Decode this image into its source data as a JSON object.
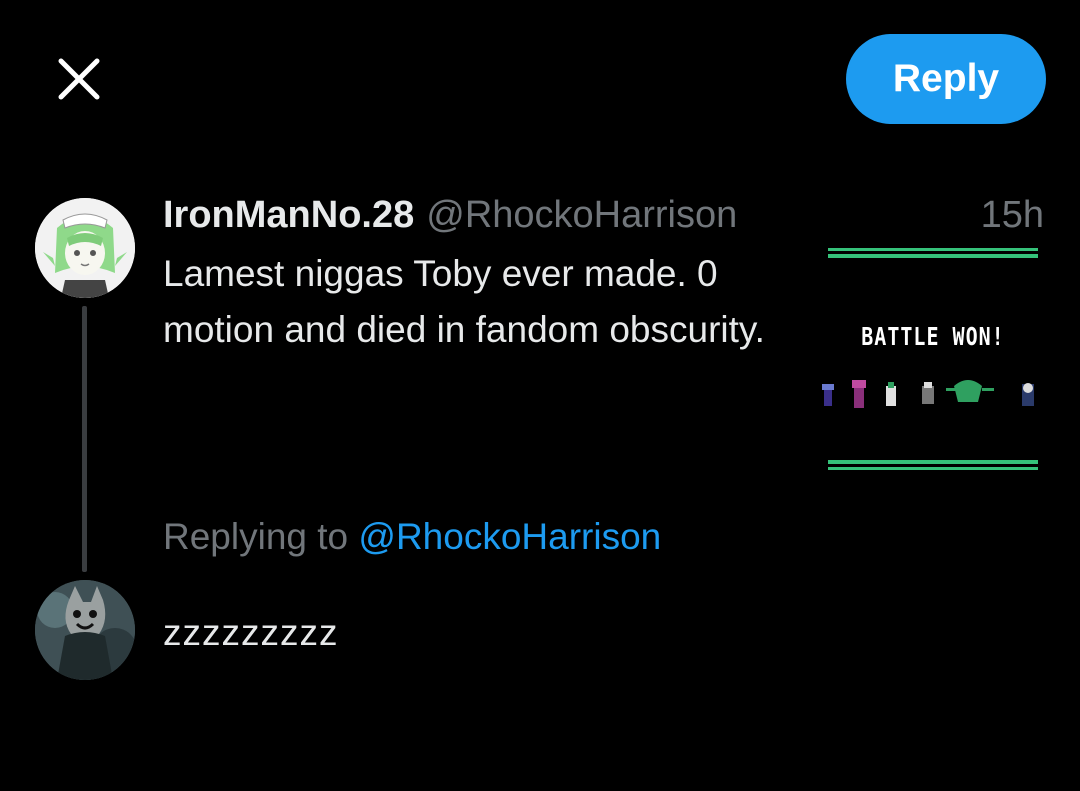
{
  "header": {
    "close_icon": "close-icon",
    "reply_label": "Reply",
    "reply_color": "#1d9bf0"
  },
  "original_tweet": {
    "display_name": "IronManNo.28",
    "handle": "@RhockoHarrison",
    "timestamp": "15h",
    "text": "Lamest niggas Toby ever made. 0 motion and died in fandom obscurity.",
    "media": {
      "caption": "BATTLE WON!"
    }
  },
  "reply": {
    "replying_to_label": "Replying to",
    "replying_to_handle": "@RhockoHarrison",
    "text": "zzzzzzzzz"
  },
  "colors": {
    "background": "#000000",
    "primary_text": "#e7e9ea",
    "secondary_text": "#71767b",
    "accent": "#1d9bf0"
  }
}
